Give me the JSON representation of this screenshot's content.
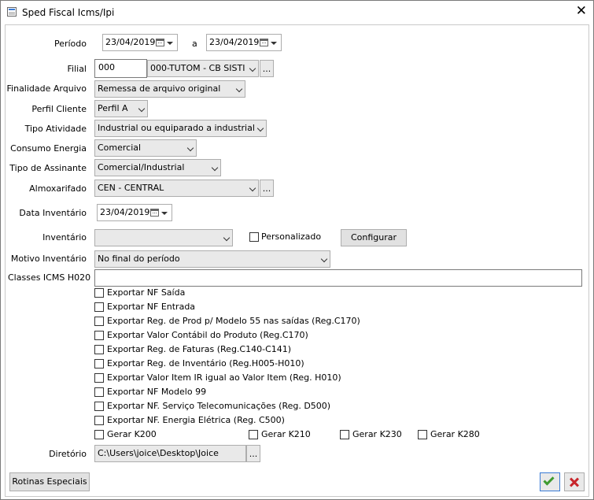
{
  "window": {
    "title": "Sped Fiscal Icms/Ipi"
  },
  "periodo": {
    "label": "Período",
    "from": "23/04/2019",
    "separator": "a",
    "to": "23/04/2019"
  },
  "filial": {
    "label": "Filial",
    "code": "000",
    "name": "000-TUTOM - CB SISTI"
  },
  "finalidade": {
    "label": "Finalidade Arquivo",
    "value": "Remessa de arquivo original"
  },
  "perfil": {
    "label": "Perfil Cliente",
    "value": "Perfil A"
  },
  "tipo_atividade": {
    "label": "Tipo Atividade",
    "value": "Industrial ou equiparado a industrial"
  },
  "consumo_energia": {
    "label": "Consumo Energia",
    "value": "Comercial"
  },
  "tipo_assinante": {
    "label": "Tipo de Assinante",
    "value": "Comercial/Industrial"
  },
  "almoxarifado": {
    "label": "Almoxarifado",
    "value": "CEN - CENTRAL"
  },
  "data_inventario": {
    "label": "Data Inventário",
    "value": "23/04/2019"
  },
  "inventario": {
    "label": "Inventário",
    "value": "",
    "personalizado_label": "Personalizado",
    "configurar_label": "Configurar"
  },
  "motivo_inventario": {
    "label": "Motivo Inventário",
    "value": "No final do período"
  },
  "classes_icms": {
    "label": "Classes ICMS H020",
    "value": ""
  },
  "checkboxes": [
    {
      "label": "Exportar NF Saída",
      "checked": false
    },
    {
      "label": "Exportar NF Entrada",
      "checked": false
    },
    {
      "label": "Exportar Reg. de Prod p/ Modelo 55 nas saídas (Reg.C170)",
      "checked": false
    },
    {
      "label": "Exportar Valor Contábil do Produto (Reg.C170)",
      "checked": false
    },
    {
      "label": "Exportar Reg. de Faturas (Reg.C140-C141)",
      "checked": false
    },
    {
      "label": "Exportar Reg. de Inventário (Reg.H005-H010)",
      "checked": false
    },
    {
      "label": "Exportar Valor Item IR igual ao Valor Item (Reg. H010)",
      "checked": false
    },
    {
      "label": "Exportar NF Modelo 99",
      "checked": false
    },
    {
      "label": "Exportar NF. Serviço Telecomunicações (Reg. D500)",
      "checked": false
    },
    {
      "label": "Exportar NF. Energia Elétrica (Reg. C500)",
      "checked": false
    }
  ],
  "gerar": [
    {
      "label": "Gerar K200",
      "checked": false
    },
    {
      "label": "Gerar K210",
      "checked": false
    },
    {
      "label": "Gerar K230",
      "checked": false
    },
    {
      "label": "Gerar K280",
      "checked": false
    }
  ],
  "diretorio": {
    "label": "Diretório",
    "value": "C:\\Users\\joice\\Desktop\\Joice"
  },
  "footer": {
    "rotinas_label": "Rotinas Especiais"
  },
  "ellipsis": "...",
  "colors": {
    "ok": "#3f9b2f",
    "cancel": "#c8252b",
    "focus_border": "#3a7bd5"
  }
}
